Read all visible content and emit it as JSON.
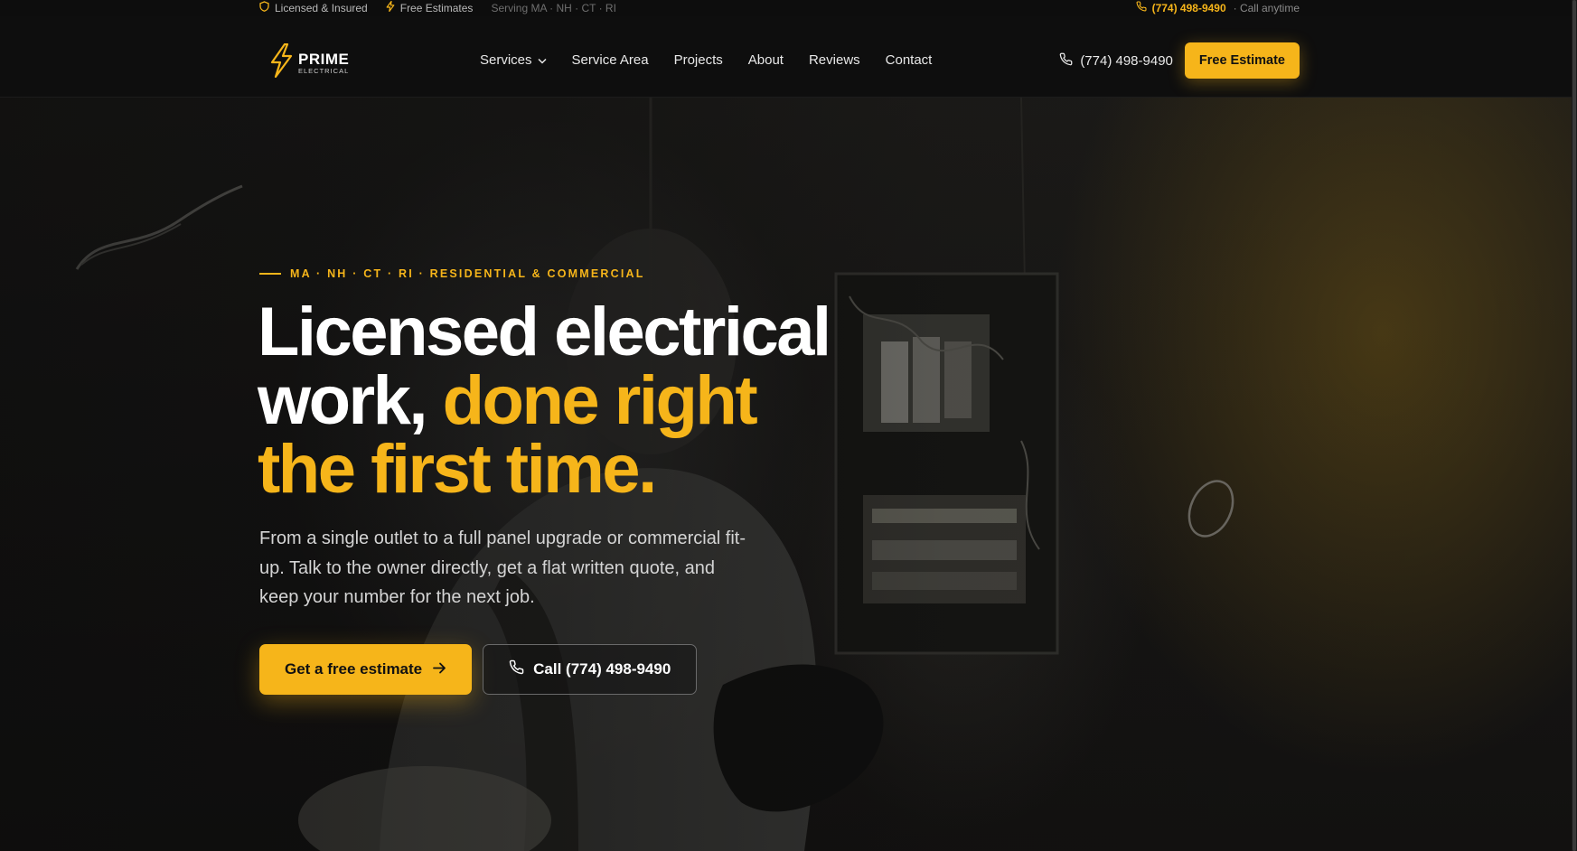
{
  "topbar": {
    "licensed": "Licensed & Insured",
    "free_estimates": "Free Estimates",
    "serving": "Serving MA · NH · CT · RI",
    "phone": "(774) 498-9490",
    "call_anytime": "· Call anytime"
  },
  "nav": {
    "logo_word": "PRIME",
    "logo_sub": "ELECTRICAL",
    "menu": [
      "Services",
      "Service Area",
      "Projects",
      "About",
      "Reviews",
      "Contact"
    ],
    "phone": "(774) 498-9490",
    "cta": "Free Estimate"
  },
  "hero": {
    "eyebrow": "MA · NH · CT · RI · RESIDENTIAL & COMMERCIAL",
    "headline_white_1": "Licensed electrical",
    "headline_white_2": "work, ",
    "headline_accent_1": "done right",
    "headline_accent_2": "the first time.",
    "sub": "From a single outlet to a full panel upgrade or commercial fit-up. Talk to the owner directly, get a flat written quote, and keep your number for the next job.",
    "cta_primary": "Get a free estimate",
    "cta_secondary": "Call (774) 498-9490"
  },
  "colors": {
    "accent": "#f6b51a",
    "background": "#0e0e0e",
    "text": "#ffffff"
  },
  "icons": {
    "licensed": "shield-icon",
    "estimates": "lightning-icon",
    "phone": "phone-icon",
    "dropdown": "chevron-down-icon",
    "arrow": "arrow-right-icon",
    "logo": "lightning-bolt-logo-icon"
  }
}
